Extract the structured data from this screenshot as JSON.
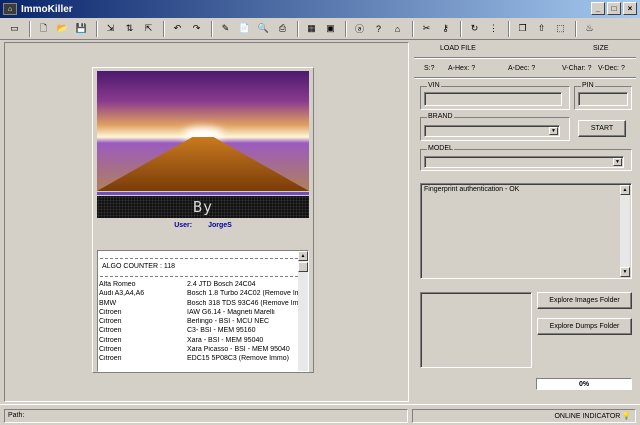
{
  "window": {
    "title": "ImmoKiller"
  },
  "toolbar": {
    "groups": [
      [
        "run-icon"
      ],
      [
        "new-file-icon",
        "open-folder-icon",
        "save-icon"
      ],
      [
        "import-icon",
        "transfer-icon",
        "export-icon"
      ],
      [
        "undo-icon",
        "redo-icon"
      ],
      [
        "edit-page-icon",
        "document-icon",
        "find-icon",
        "print-icon"
      ],
      [
        "calculator-icon",
        "chip-icon"
      ],
      [
        "info-icon",
        "help-icon",
        "hat-icon"
      ],
      [
        "tools-icon",
        "key-icon"
      ],
      [
        "refresh-icon",
        "columns-icon"
      ],
      [
        "copy-icon",
        "upload-icon",
        "select-icon"
      ],
      [
        "bottle-icon"
      ]
    ]
  },
  "card": {
    "dot_text": "By",
    "user_label": "User:",
    "user_value": "JorgeS",
    "algo_counter": "ALGO COUNTER : 118",
    "rows": [
      [
        "Alfa Romeo",
        "2.4 JTD Bosch 24C04"
      ],
      [
        "Audi A3,A4,A6",
        "Bosch 1.8 Turbo 24C02 (Remove Imm"
      ],
      [
        "BMW",
        "Bosch 318 TDS 93C46 (Remove Imm"
      ],
      [
        "Citroen",
        "IAW G6.14 - Magneti Marelli"
      ],
      [
        "Citroen",
        "Berlingo - BSI - MCU NEC"
      ],
      [
        "Citroen",
        "C3- BSI - MEM 95160"
      ],
      [
        "Citroen",
        "Xara - BSI - MEM 95040"
      ],
      [
        "Citroen",
        "Xara Picasso    - BSI - MEM 95040"
      ],
      [
        "Citroen",
        "EDC15 5P08C3 (Remove Immo)"
      ]
    ]
  },
  "right": {
    "load_file": "LOAD FILE",
    "size": "SIZE",
    "s_label": "S:?",
    "a_hex": "A-Hex: ?",
    "a_dec": "A-Dec: ?",
    "v_char": "V-Char: ?",
    "v_dec": "V-Dec: ?",
    "vin_label": "VIN",
    "pin_label": "PIN",
    "brand_label": "BRAND",
    "model_label": "MODEL",
    "start_label": "START",
    "log_text": "Fingerprint authentication - OK",
    "explore_images": "Explore Images Folder",
    "explore_dumps": "Explore Dumps Folder",
    "progress": "0%"
  },
  "status": {
    "path_label": "Path:",
    "online_indicator": "ONLINE INDICATOR"
  }
}
